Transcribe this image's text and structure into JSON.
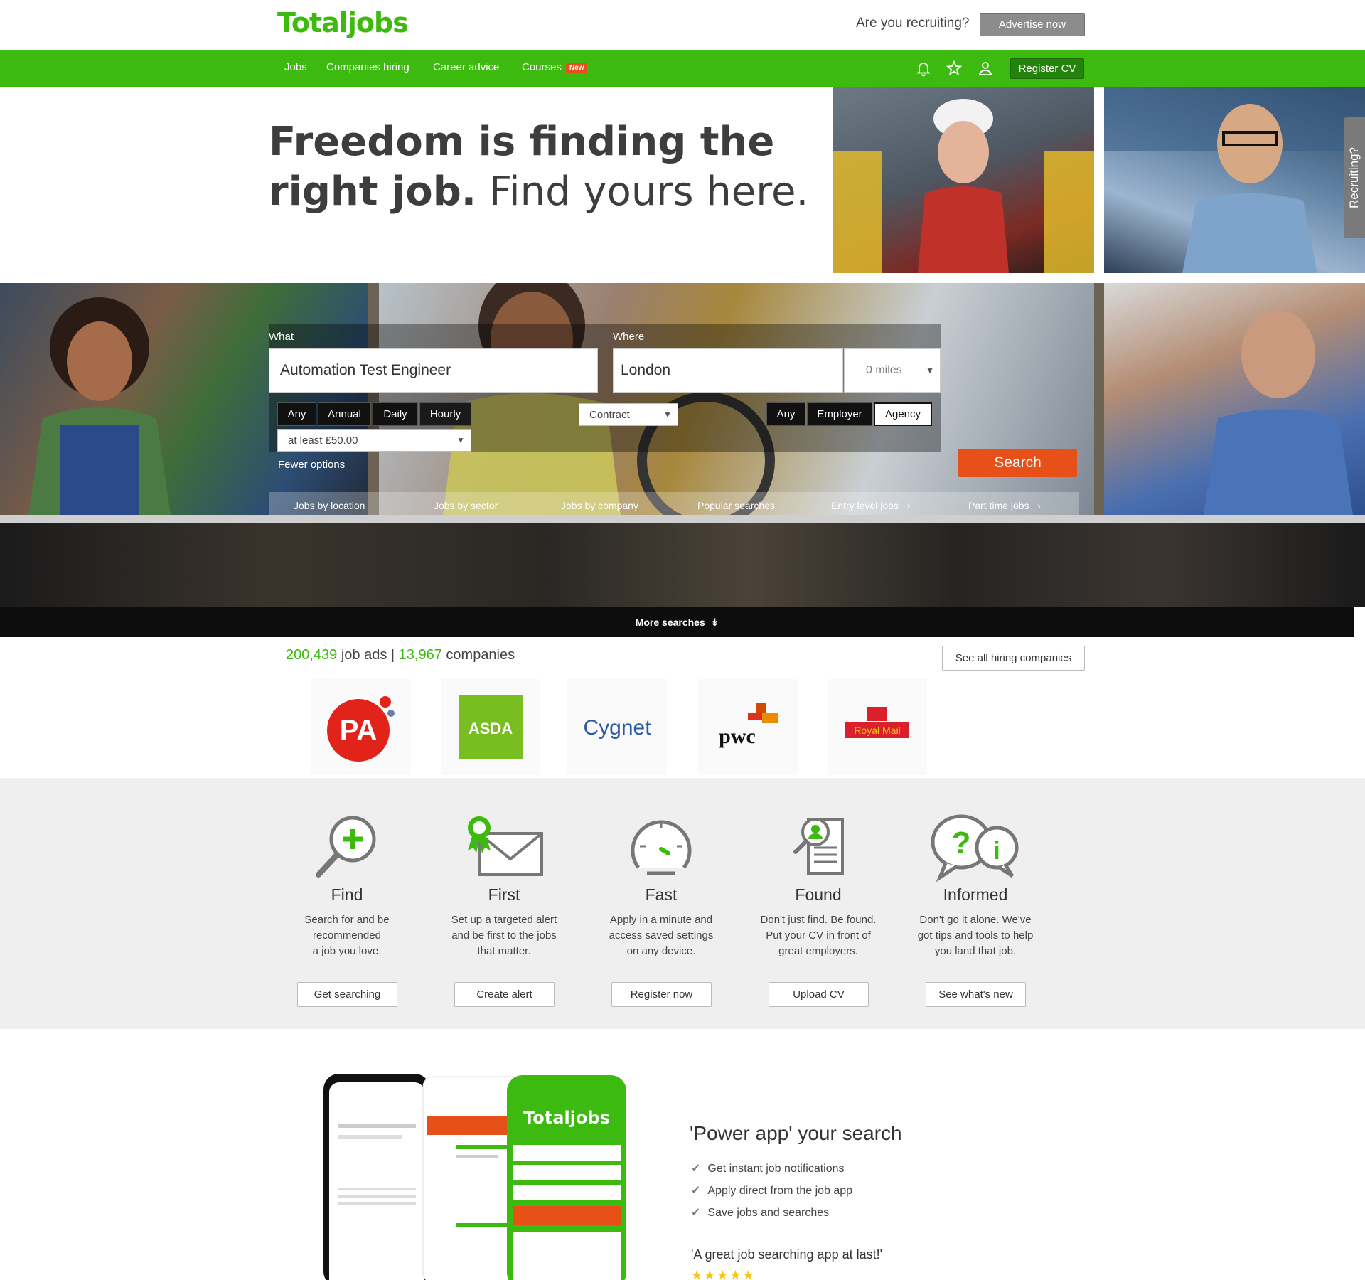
{
  "header": {
    "logo": "Totaljobs",
    "recruiting_question": "Are you recruiting?",
    "advertise_label": "Advertise now"
  },
  "nav": {
    "items": [
      "Jobs",
      "Companies hiring",
      "Career advice",
      "Courses"
    ],
    "courses_badge": "New",
    "register_cv": "Register CV"
  },
  "hero": {
    "headline_bold_1": "Freedom is finding the",
    "headline_bold_2": "right job.",
    "headline_light": "Find yours here.",
    "recruiting_tab": "Recruiting?"
  },
  "search": {
    "what_label": "What",
    "what_value": "Automation Test Engineer",
    "where_label": "Where",
    "where_value": "London",
    "miles_value": "0 miles",
    "salary_periods": [
      "Any",
      "Annual",
      "Daily",
      "Hourly"
    ],
    "salary_selected": "Hourly",
    "salary_min": "at least £50.00",
    "job_type": "Contract",
    "posted_by": [
      "Any",
      "Employer",
      "Agency"
    ],
    "posted_by_selected": "Agency",
    "fewer_options": "Fewer options",
    "search_label": "Search",
    "quick_tabs": [
      "Jobs by location",
      "Jobs by sector",
      "Jobs by company",
      "Popular searches",
      "Entry level jobs",
      "Part time jobs"
    ],
    "more_searches": "More searches"
  },
  "stats": {
    "job_ads_count": "200,439",
    "job_ads_label": "job ads |",
    "companies_count": "13,967",
    "companies_label": "companies",
    "see_all": "See all hiring companies"
  },
  "companies": [
    {
      "name": "PA",
      "color": "#e2231a"
    },
    {
      "name": "ASDA",
      "color": "#78be20"
    },
    {
      "name": "Cygnet",
      "color": "#2d5aa7"
    },
    {
      "name": "pwc",
      "color": "#111111"
    },
    {
      "name": "Royal Mail",
      "color": "#da202a"
    }
  ],
  "features": [
    {
      "icon": "magnifier-plus-icon",
      "title": "Find",
      "text": [
        "Search for and be",
        "recommended",
        "a job you love."
      ],
      "button": "Get searching"
    },
    {
      "icon": "envelope-badge-icon",
      "title": "First",
      "text": [
        "Set up a targeted alert",
        "and be first to the jobs",
        "that matter."
      ],
      "button": "Create alert"
    },
    {
      "icon": "speedometer-icon",
      "title": "Fast",
      "text": [
        "Apply in a minute and",
        "access saved settings",
        "on any device."
      ],
      "button": "Register now"
    },
    {
      "icon": "cv-search-icon",
      "title": "Found",
      "text": [
        "Don't just find. Be found.",
        "Put your CV in front of",
        "great employers."
      ],
      "button": "Upload CV"
    },
    {
      "icon": "chat-bubbles-icon",
      "title": "Informed",
      "text": [
        "Don't go it alone. We've",
        "got tips and tools to help",
        "you land that job."
      ],
      "button": "See what's new"
    }
  ],
  "app": {
    "title": "'Power app' your search",
    "bullets": [
      "Get instant job notifications",
      "Apply direct from the job app",
      "Save jobs and searches"
    ],
    "quote": "'A great job searching app at last!'",
    "stars": "★★★★★"
  },
  "colors": {
    "brand_green": "#3dba0f",
    "dark_green": "#24830a",
    "search_orange": "#e8501a"
  }
}
